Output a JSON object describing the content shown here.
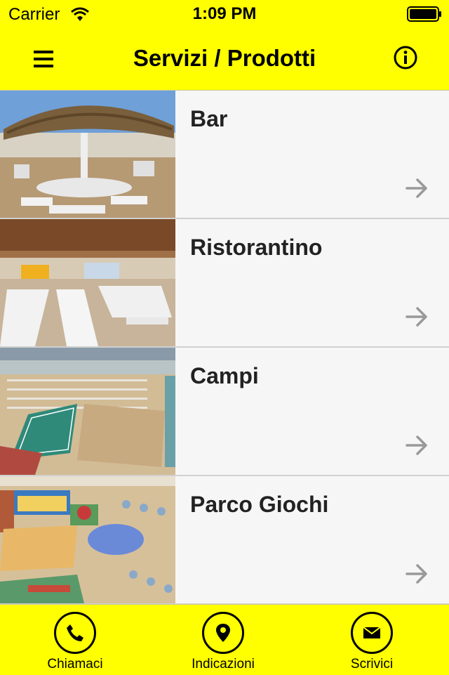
{
  "status": {
    "carrier": "Carrier",
    "time": "1:09 PM"
  },
  "nav": {
    "title": "Servizi / Prodotti",
    "menu_icon": "hamburger-menu-icon",
    "info_icon": "info-circle-icon"
  },
  "colors": {
    "brand_yellow": "#ffff00",
    "row_background": "#f6f6f6",
    "arrow_gray": "#999999"
  },
  "list": {
    "items": [
      {
        "label": "Bar",
        "image": "beach-bar-thatched-umbrella-photo"
      },
      {
        "label": "Ristorantino",
        "image": "restaurant-interior-tables-photo"
      },
      {
        "label": "Campi",
        "image": "beach-sports-courts-aerial-photo"
      },
      {
        "label": "Parco Giochi",
        "image": "beach-playground-aerial-photo"
      }
    ]
  },
  "tabbar": {
    "items": [
      {
        "label": "Chiamaci",
        "icon": "phone-icon"
      },
      {
        "label": "Indicazioni",
        "icon": "map-pin-icon"
      },
      {
        "label": "Scrivici",
        "icon": "envelope-icon"
      }
    ]
  }
}
